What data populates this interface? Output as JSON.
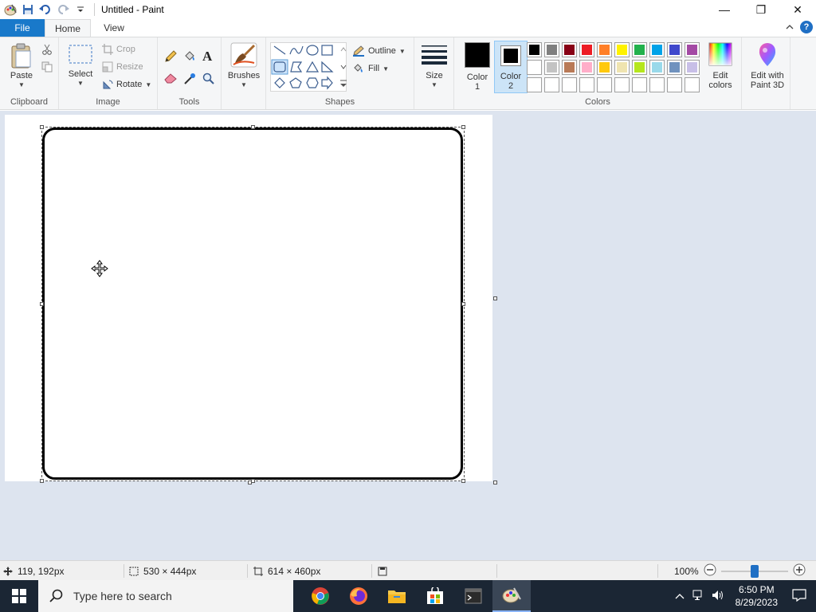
{
  "window": {
    "title": "Untitled - Paint",
    "controls": {
      "minimize": "—",
      "restore": "❐",
      "close": "✕"
    }
  },
  "tabs": {
    "file": "File",
    "home": "Home",
    "view": "View"
  },
  "ribbon": {
    "clipboard": {
      "label": "Clipboard",
      "paste": "Paste"
    },
    "image": {
      "label": "Image",
      "select": "Select",
      "crop": "Crop",
      "resize": "Resize",
      "rotate": "Rotate"
    },
    "tools": {
      "label": "Tools"
    },
    "brushes": {
      "label": "Brushes"
    },
    "shapes": {
      "label": "Shapes",
      "outline": "Outline",
      "fill": "Fill"
    },
    "size": {
      "label": "Size"
    },
    "colors": {
      "label": "Colors",
      "color1": "Color\n1",
      "color1_a": "Color",
      "color1_b": "1",
      "color2_a": "Color",
      "color2_b": "2",
      "edit_a": "Edit",
      "edit_b": "colors",
      "paint3d_a": "Edit with",
      "paint3d_b": "Paint 3D",
      "color1_value": "#000000",
      "color2_value": "#000000",
      "palette_row1": [
        "#000000",
        "#7f7f7f",
        "#880015",
        "#ed1c24",
        "#ff7f27",
        "#fff200",
        "#22b14c",
        "#00a2e8",
        "#3f48cc",
        "#a349a4"
      ],
      "palette_row2": [
        "#ffffff",
        "#c3c3c3",
        "#b97a57",
        "#ffaec9",
        "#ffc90e",
        "#efe4b0",
        "#b5e61d",
        "#99d9ea",
        "#7092be",
        "#c8bfe7"
      ],
      "palette_row3": [
        "#ffffff",
        "#ffffff",
        "#ffffff",
        "#ffffff",
        "#ffffff",
        "#ffffff",
        "#ffffff",
        "#ffffff",
        "#ffffff",
        "#ffffff"
      ]
    }
  },
  "status": {
    "cursor_pos": "119, 192px",
    "selection_size": "530 × 444px",
    "image_size": "614 × 460px",
    "zoom": "100%",
    "zoom_level": 0.5
  },
  "taskbar": {
    "search_placeholder": "Type here to search",
    "time": "6:50 PM",
    "date": "8/29/2023"
  }
}
